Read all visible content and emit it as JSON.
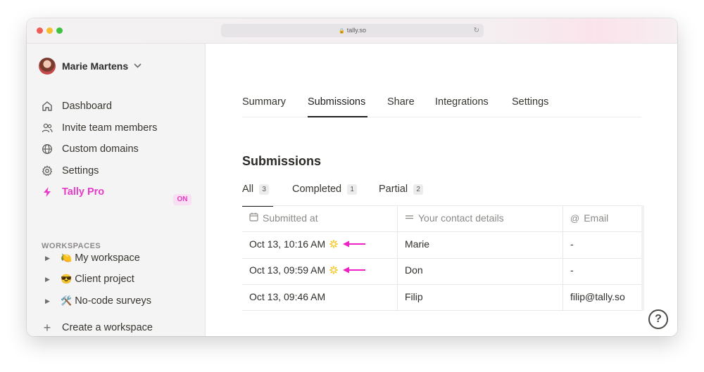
{
  "browser": {
    "url": "tally.so"
  },
  "sidebar": {
    "user_name": "Marie Martens",
    "nav": [
      {
        "label": "Dashboard",
        "icon": "home-icon"
      },
      {
        "label": "Invite team members",
        "icon": "users-icon"
      },
      {
        "label": "Custom domains",
        "icon": "globe-icon"
      },
      {
        "label": "Settings",
        "icon": "gear-icon"
      },
      {
        "label": "Tally Pro",
        "icon": "lightning-icon",
        "badge": "ON"
      }
    ],
    "workspaces_label": "WORKSPACES",
    "workspaces": [
      {
        "emoji": "🍋",
        "label": "My workspace"
      },
      {
        "emoji": "😎",
        "label": "Client project"
      },
      {
        "emoji": "🛠️",
        "label": "No-code surveys"
      }
    ],
    "create_workspace": "Create a workspace"
  },
  "main": {
    "tabs": [
      "Summary",
      "Submissions",
      "Share",
      "Integrations",
      "Settings"
    ],
    "active_tab": "Submissions",
    "heading": "Submissions",
    "filters": [
      {
        "label": "All",
        "count": "3"
      },
      {
        "label": "Completed",
        "count": "1"
      },
      {
        "label": "Partial",
        "count": "2"
      }
    ],
    "table": {
      "columns": [
        "Submitted at",
        "Your contact details",
        "Email"
      ],
      "rows": [
        {
          "submitted_at": "Oct 13, 10:16 AM",
          "contact": "Marie",
          "email": "-",
          "partial": true
        },
        {
          "submitted_at": "Oct 13, 09:59 AM",
          "contact": "Don",
          "email": "-",
          "partial": true
        },
        {
          "submitted_at": "Oct 13, 09:46 AM",
          "contact": "Filip",
          "email": "filip@tally.so",
          "partial": false
        }
      ]
    },
    "help_label": "?"
  },
  "colors": {
    "accent_pink": "#e83ac9",
    "arrow_pink": "#ee22c4",
    "spark_yellow": "#f5c000"
  }
}
